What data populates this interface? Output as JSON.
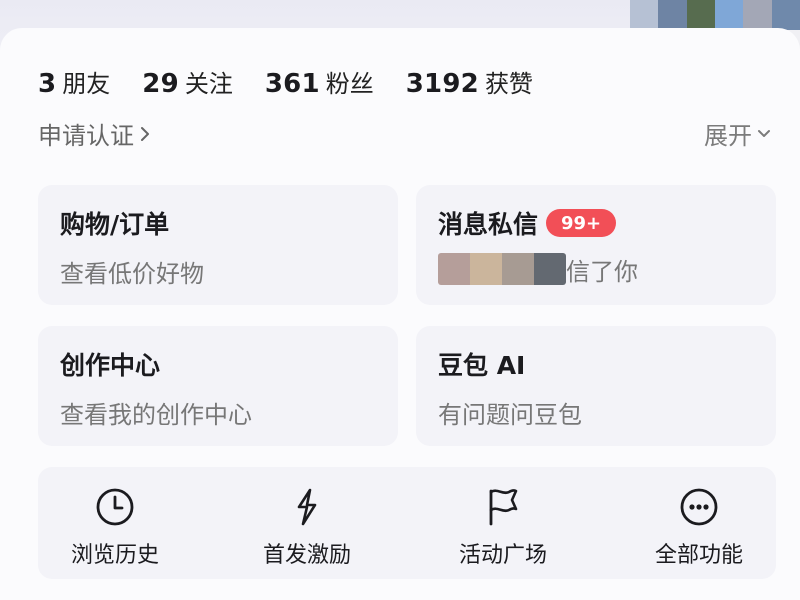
{
  "profile": {
    "stats": [
      {
        "value": "3",
        "label": "朋友"
      },
      {
        "value": "29",
        "label": "关注"
      },
      {
        "value": "361",
        "label": "粉丝"
      },
      {
        "value": "3192",
        "label": "获赞"
      }
    ],
    "verify_label": "申请认证",
    "expand_label": "展开"
  },
  "cards": {
    "shopping": {
      "title": "购物/订单",
      "subtitle": "查看低价好物"
    },
    "messages": {
      "title": "消息私信",
      "badge": "99+",
      "subtitle": "信了你"
    },
    "creator": {
      "title": "创作中心",
      "subtitle": "查看我的创作中心"
    },
    "doubao": {
      "title": "豆包 AI",
      "subtitle": "有问题问豆包"
    }
  },
  "tools": [
    {
      "label": "浏览历史",
      "icon": "clock-icon"
    },
    {
      "label": "首发激励",
      "icon": "spark-icon"
    },
    {
      "label": "活动广场",
      "icon": "flag-icon"
    },
    {
      "label": "全部功能",
      "icon": "more-icon"
    }
  ],
  "colors": {
    "accent": "#f24f57",
    "muted": "#777777",
    "card": "#f3f3f8"
  }
}
